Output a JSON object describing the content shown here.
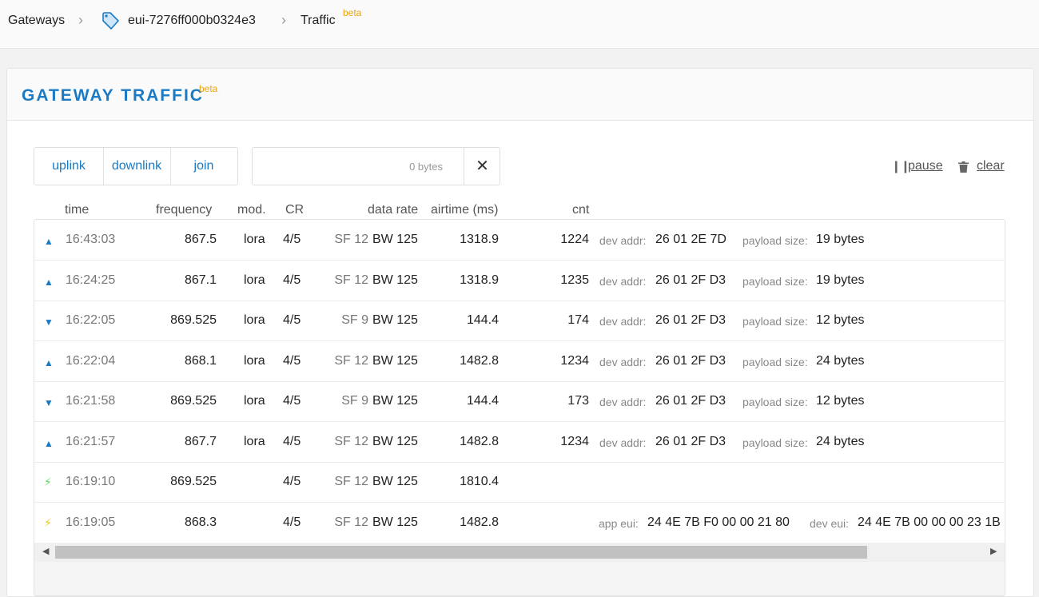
{
  "breadcrumb": {
    "items": [
      "Gateways",
      "eui-7276ff000b0324e3",
      "Traffic"
    ],
    "beta": "beta"
  },
  "card": {
    "title": "GATEWAY TRAFFIC",
    "beta": "beta"
  },
  "filters": [
    "uplink",
    "downlink",
    "join"
  ],
  "search": {
    "placeholder": "0 bytes"
  },
  "actions": {
    "pause": "pause",
    "clear": "clear"
  },
  "columns": [
    "time",
    "frequency",
    "mod.",
    "CR",
    "data rate",
    "airtime (ms)",
    "cnt"
  ],
  "colors": {
    "accent": "#1a7ac4",
    "beta": "#e8a317",
    "join_green": "#5cd65c",
    "join_yellow": "#f0c419"
  },
  "rows": [
    {
      "dir": "up",
      "time": "16:43:03",
      "freq": "867.5",
      "mod": "lora",
      "cr": "4/5",
      "sf": "SF 12",
      "bw": "BW 125",
      "airtime": "1318.9",
      "cnt": "1224",
      "l1": "dev addr:",
      "v1": "26 01 2E 7D",
      "l2": "payload size:",
      "v2": "19 bytes"
    },
    {
      "dir": "up",
      "time": "16:24:25",
      "freq": "867.1",
      "mod": "lora",
      "cr": "4/5",
      "sf": "SF 12",
      "bw": "BW 125",
      "airtime": "1318.9",
      "cnt": "1235",
      "l1": "dev addr:",
      "v1": "26 01 2F D3",
      "l2": "payload size:",
      "v2": "19 bytes"
    },
    {
      "dir": "down",
      "time": "16:22:05",
      "freq": "869.525",
      "mod": "lora",
      "cr": "4/5",
      "sf": "SF 9",
      "bw": "BW 125",
      "airtime": "144.4",
      "cnt": "174",
      "l1": "dev addr:",
      "v1": "26 01 2F D3",
      "l2": "payload size:",
      "v2": "12 bytes"
    },
    {
      "dir": "up",
      "time": "16:22:04",
      "freq": "868.1",
      "mod": "lora",
      "cr": "4/5",
      "sf": "SF 12",
      "bw": "BW 125",
      "airtime": "1482.8",
      "cnt": "1234",
      "l1": "dev addr:",
      "v1": "26 01 2F D3",
      "l2": "payload size:",
      "v2": "24 bytes"
    },
    {
      "dir": "down",
      "time": "16:21:58",
      "freq": "869.525",
      "mod": "lora",
      "cr": "4/5",
      "sf": "SF 9",
      "bw": "BW 125",
      "airtime": "144.4",
      "cnt": "173",
      "l1": "dev addr:",
      "v1": "26 01 2F D3",
      "l2": "payload size:",
      "v2": "12 bytes"
    },
    {
      "dir": "up",
      "time": "16:21:57",
      "freq": "867.7",
      "mod": "lora",
      "cr": "4/5",
      "sf": "SF 12",
      "bw": "BW 125",
      "airtime": "1482.8",
      "cnt": "1234",
      "l1": "dev addr:",
      "v1": "26 01 2F D3",
      "l2": "payload size:",
      "v2": "24 bytes"
    },
    {
      "dir": "join-accept",
      "time": "16:19:10",
      "freq": "869.525",
      "mod": "",
      "cr": "4/5",
      "sf": "SF 12",
      "bw": "BW 125",
      "airtime": "1810.4",
      "cnt": "",
      "l1": "",
      "v1": "",
      "l2": "",
      "v2": ""
    },
    {
      "dir": "join-request",
      "time": "16:19:05",
      "freq": "868.3",
      "mod": "",
      "cr": "4/5",
      "sf": "SF 12",
      "bw": "BW 125",
      "airtime": "1482.8",
      "cnt": "",
      "l1": "app eui:",
      "v1": "24 4E 7B F0 00 00 21 80",
      "l2": "dev eui:",
      "v2": "24 4E 7B 00 00 00 23 1B"
    }
  ]
}
